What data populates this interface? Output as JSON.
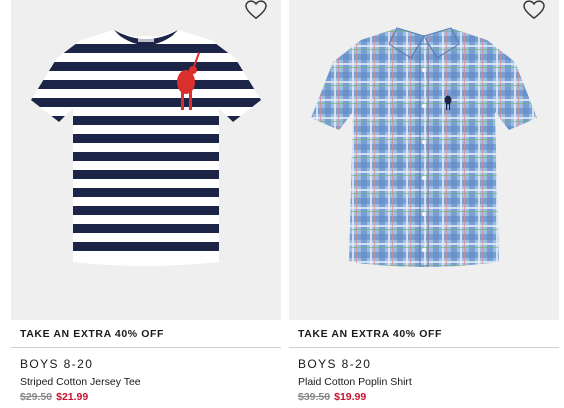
{
  "products": [
    {
      "promo": "TAKE AN EXTRA 40% OFF",
      "category": "BOYS 8-20",
      "name": "Striped Cotton Jersey Tee",
      "original_price": "$29.50",
      "sale_price": "$21.99",
      "image_icon": "striped-tee-image",
      "colors": {
        "stripe": "#1c2447",
        "logo": "#d9302c"
      }
    },
    {
      "promo": "TAKE AN EXTRA 40% OFF",
      "category": "BOYS 8-20",
      "name": "Plaid Cotton Poplin Shirt",
      "original_price": "$39.50",
      "sale_price": "$19.99",
      "image_icon": "plaid-shirt-image",
      "colors": {
        "base": "#7fa8d6",
        "logo": "#1c2447"
      }
    }
  ],
  "colors": {
    "sale_price": "#c8102e",
    "old_price": "#888888",
    "image_bg": "#efefef"
  }
}
